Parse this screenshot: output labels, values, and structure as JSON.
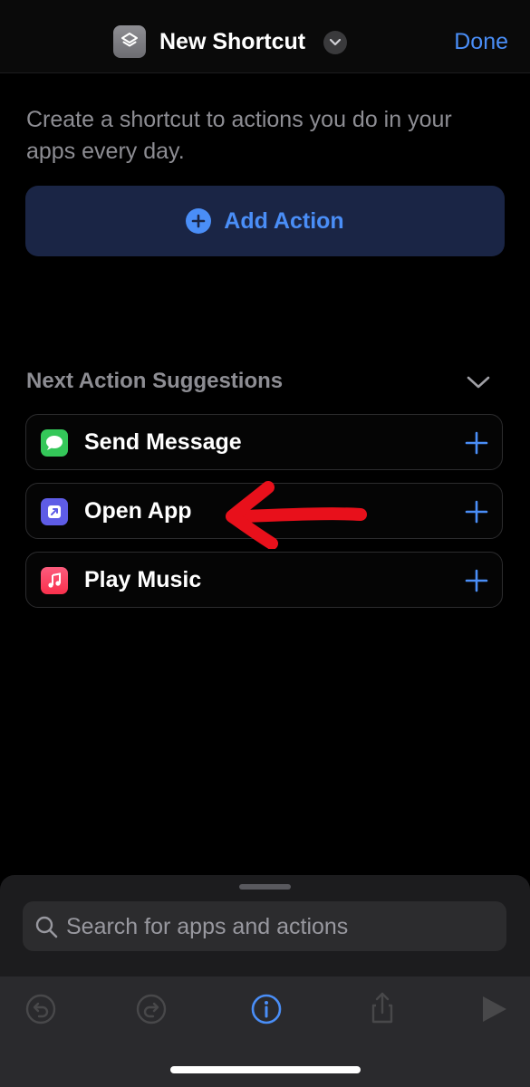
{
  "header": {
    "title": "New Shortcut",
    "done_label": "Done"
  },
  "intro": {
    "text": "Create a shortcut to actions you do in your apps every day."
  },
  "add_action": {
    "label": "Add Action"
  },
  "suggestions": {
    "header": "Next Action Suggestions",
    "items": [
      {
        "label": "Send Message",
        "icon": "messages-icon",
        "color": "#34c759"
      },
      {
        "label": "Open App",
        "icon": "open-app-icon",
        "color": "#5e5ce6"
      },
      {
        "label": "Play Music",
        "icon": "music-icon",
        "color": "#fa3e57"
      }
    ]
  },
  "search": {
    "placeholder": "Search for apps and actions"
  },
  "toolbar": {
    "buttons": [
      "undo-icon",
      "redo-icon",
      "info-icon",
      "share-icon",
      "play-icon"
    ]
  },
  "colors": {
    "accent": "#4a8ef7",
    "annotation": "#e8101b"
  }
}
